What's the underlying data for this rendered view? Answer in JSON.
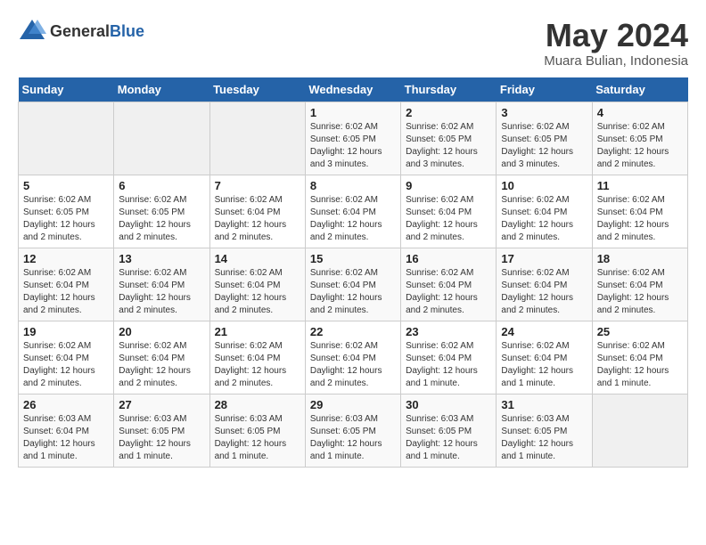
{
  "logo": {
    "text_general": "General",
    "text_blue": "Blue"
  },
  "title": "May 2024",
  "subtitle": "Muara Bulian, Indonesia",
  "days_of_week": [
    "Sunday",
    "Monday",
    "Tuesday",
    "Wednesday",
    "Thursday",
    "Friday",
    "Saturday"
  ],
  "weeks": [
    [
      {
        "day": "",
        "info": ""
      },
      {
        "day": "",
        "info": ""
      },
      {
        "day": "",
        "info": ""
      },
      {
        "day": "1",
        "info": "Sunrise: 6:02 AM\nSunset: 6:05 PM\nDaylight: 12 hours\nand 3 minutes."
      },
      {
        "day": "2",
        "info": "Sunrise: 6:02 AM\nSunset: 6:05 PM\nDaylight: 12 hours\nand 3 minutes."
      },
      {
        "day": "3",
        "info": "Sunrise: 6:02 AM\nSunset: 6:05 PM\nDaylight: 12 hours\nand 3 minutes."
      },
      {
        "day": "4",
        "info": "Sunrise: 6:02 AM\nSunset: 6:05 PM\nDaylight: 12 hours\nand 2 minutes."
      }
    ],
    [
      {
        "day": "5",
        "info": "Sunrise: 6:02 AM\nSunset: 6:05 PM\nDaylight: 12 hours\nand 2 minutes."
      },
      {
        "day": "6",
        "info": "Sunrise: 6:02 AM\nSunset: 6:05 PM\nDaylight: 12 hours\nand 2 minutes."
      },
      {
        "day": "7",
        "info": "Sunrise: 6:02 AM\nSunset: 6:04 PM\nDaylight: 12 hours\nand 2 minutes."
      },
      {
        "day": "8",
        "info": "Sunrise: 6:02 AM\nSunset: 6:04 PM\nDaylight: 12 hours\nand 2 minutes."
      },
      {
        "day": "9",
        "info": "Sunrise: 6:02 AM\nSunset: 6:04 PM\nDaylight: 12 hours\nand 2 minutes."
      },
      {
        "day": "10",
        "info": "Sunrise: 6:02 AM\nSunset: 6:04 PM\nDaylight: 12 hours\nand 2 minutes."
      },
      {
        "day": "11",
        "info": "Sunrise: 6:02 AM\nSunset: 6:04 PM\nDaylight: 12 hours\nand 2 minutes."
      }
    ],
    [
      {
        "day": "12",
        "info": "Sunrise: 6:02 AM\nSunset: 6:04 PM\nDaylight: 12 hours\nand 2 minutes."
      },
      {
        "day": "13",
        "info": "Sunrise: 6:02 AM\nSunset: 6:04 PM\nDaylight: 12 hours\nand 2 minutes."
      },
      {
        "day": "14",
        "info": "Sunrise: 6:02 AM\nSunset: 6:04 PM\nDaylight: 12 hours\nand 2 minutes."
      },
      {
        "day": "15",
        "info": "Sunrise: 6:02 AM\nSunset: 6:04 PM\nDaylight: 12 hours\nand 2 minutes."
      },
      {
        "day": "16",
        "info": "Sunrise: 6:02 AM\nSunset: 6:04 PM\nDaylight: 12 hours\nand 2 minutes."
      },
      {
        "day": "17",
        "info": "Sunrise: 6:02 AM\nSunset: 6:04 PM\nDaylight: 12 hours\nand 2 minutes."
      },
      {
        "day": "18",
        "info": "Sunrise: 6:02 AM\nSunset: 6:04 PM\nDaylight: 12 hours\nand 2 minutes."
      }
    ],
    [
      {
        "day": "19",
        "info": "Sunrise: 6:02 AM\nSunset: 6:04 PM\nDaylight: 12 hours\nand 2 minutes."
      },
      {
        "day": "20",
        "info": "Sunrise: 6:02 AM\nSunset: 6:04 PM\nDaylight: 12 hours\nand 2 minutes."
      },
      {
        "day": "21",
        "info": "Sunrise: 6:02 AM\nSunset: 6:04 PM\nDaylight: 12 hours\nand 2 minutes."
      },
      {
        "day": "22",
        "info": "Sunrise: 6:02 AM\nSunset: 6:04 PM\nDaylight: 12 hours\nand 2 minutes."
      },
      {
        "day": "23",
        "info": "Sunrise: 6:02 AM\nSunset: 6:04 PM\nDaylight: 12 hours\nand 1 minute."
      },
      {
        "day": "24",
        "info": "Sunrise: 6:02 AM\nSunset: 6:04 PM\nDaylight: 12 hours\nand 1 minute."
      },
      {
        "day": "25",
        "info": "Sunrise: 6:02 AM\nSunset: 6:04 PM\nDaylight: 12 hours\nand 1 minute."
      }
    ],
    [
      {
        "day": "26",
        "info": "Sunrise: 6:03 AM\nSunset: 6:04 PM\nDaylight: 12 hours\nand 1 minute."
      },
      {
        "day": "27",
        "info": "Sunrise: 6:03 AM\nSunset: 6:05 PM\nDaylight: 12 hours\nand 1 minute."
      },
      {
        "day": "28",
        "info": "Sunrise: 6:03 AM\nSunset: 6:05 PM\nDaylight: 12 hours\nand 1 minute."
      },
      {
        "day": "29",
        "info": "Sunrise: 6:03 AM\nSunset: 6:05 PM\nDaylight: 12 hours\nand 1 minute."
      },
      {
        "day": "30",
        "info": "Sunrise: 6:03 AM\nSunset: 6:05 PM\nDaylight: 12 hours\nand 1 minute."
      },
      {
        "day": "31",
        "info": "Sunrise: 6:03 AM\nSunset: 6:05 PM\nDaylight: 12 hours\nand 1 minute."
      },
      {
        "day": "",
        "info": ""
      }
    ]
  ]
}
